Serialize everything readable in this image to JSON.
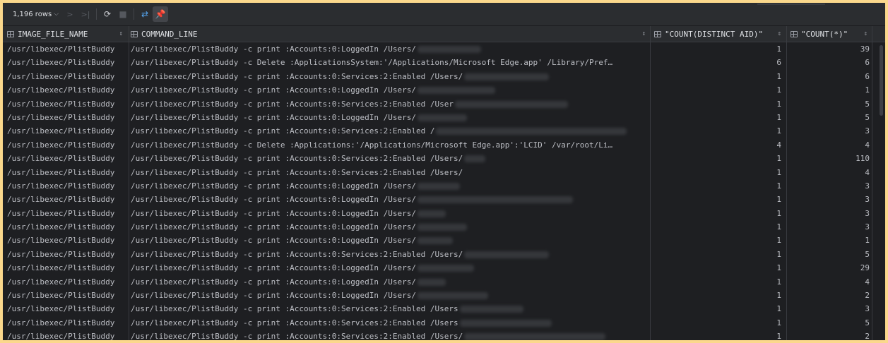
{
  "toolbar": {
    "rows_label": "1,196 rows",
    "icons": [
      "chevron-down-icon",
      "next-page-icon",
      "last-page-icon",
      "refresh-icon",
      "stop-icon",
      "transpose-icon",
      "pin-icon"
    ]
  },
  "columns": [
    {
      "name": "IMAGE_FILE_NAME"
    },
    {
      "name": "COMMAND_LINE"
    },
    {
      "name": "\"COUNT(DISTINCT AID)\""
    },
    {
      "name": "\"COUNT(*)\""
    }
  ],
  "rows": [
    {
      "image": "/usr/libexec/PlistBuddy",
      "cmd": "/usr/libexec/PlistBuddy -c print :Accounts:0:LoggedIn /Users/",
      "aid": "1",
      "count": "39"
    },
    {
      "image": "/usr/libexec/PlistBuddy",
      "cmd": "/usr/libexec/PlistBuddy -c Delete :ApplicationsSystem:'/Applications/Microsoft Edge.app' /Library/Pref…",
      "aid": "6",
      "count": "6"
    },
    {
      "image": "/usr/libexec/PlistBuddy",
      "cmd": "/usr/libexec/PlistBuddy -c print :Accounts:0:Services:2:Enabled /Users/",
      "aid": "1",
      "count": "6"
    },
    {
      "image": "/usr/libexec/PlistBuddy",
      "cmd": "/usr/libexec/PlistBuddy -c print :Accounts:0:LoggedIn /Users/",
      "aid": "1",
      "count": "1"
    },
    {
      "image": "/usr/libexec/PlistBuddy",
      "cmd": "/usr/libexec/PlistBuddy -c print :Accounts:0:Services:2:Enabled /User",
      "aid": "1",
      "count": "5"
    },
    {
      "image": "/usr/libexec/PlistBuddy",
      "cmd": "/usr/libexec/PlistBuddy -c print :Accounts:0:LoggedIn /Users/",
      "aid": "1",
      "count": "5"
    },
    {
      "image": "/usr/libexec/PlistBuddy",
      "cmd": "/usr/libexec/PlistBuddy -c print :Accounts:0:Services:2:Enabled /",
      "aid": "1",
      "count": "3"
    },
    {
      "image": "/usr/libexec/PlistBuddy",
      "cmd": "/usr/libexec/PlistBuddy -c Delete :Applications:'/Applications/Microsoft Edge.app':'LCID' /var/root/Li…",
      "aid": "4",
      "count": "4"
    },
    {
      "image": "/usr/libexec/PlistBuddy",
      "cmd": "/usr/libexec/PlistBuddy -c print :Accounts:0:Services:2:Enabled /Users/",
      "aid": "1",
      "count": "110"
    },
    {
      "image": "/usr/libexec/PlistBuddy",
      "cmd": "/usr/libexec/PlistBuddy -c print :Accounts:0:Services:2:Enabled /Users/",
      "aid": "1",
      "count": "4"
    },
    {
      "image": "/usr/libexec/PlistBuddy",
      "cmd": "/usr/libexec/PlistBuddy -c print :Accounts:0:LoggedIn /Users/",
      "aid": "1",
      "count": "3"
    },
    {
      "image": "/usr/libexec/PlistBuddy",
      "cmd": "/usr/libexec/PlistBuddy -c print :Accounts:0:LoggedIn /Users/",
      "aid": "1",
      "count": "3"
    },
    {
      "image": "/usr/libexec/PlistBuddy",
      "cmd": "/usr/libexec/PlistBuddy -c print :Accounts:0:LoggedIn /Users/",
      "aid": "1",
      "count": "3"
    },
    {
      "image": "/usr/libexec/PlistBuddy",
      "cmd": "/usr/libexec/PlistBuddy -c print :Accounts:0:LoggedIn /Users/",
      "aid": "1",
      "count": "3"
    },
    {
      "image": "/usr/libexec/PlistBuddy",
      "cmd": "/usr/libexec/PlistBuddy -c print :Accounts:0:LoggedIn /Users/",
      "aid": "1",
      "count": "1"
    },
    {
      "image": "/usr/libexec/PlistBuddy",
      "cmd": "/usr/libexec/PlistBuddy -c print :Accounts:0:Services:2:Enabled /Users/",
      "aid": "1",
      "count": "5"
    },
    {
      "image": "/usr/libexec/PlistBuddy",
      "cmd": "/usr/libexec/PlistBuddy -c print :Accounts:0:LoggedIn /Users/",
      "aid": "1",
      "count": "29"
    },
    {
      "image": "/usr/libexec/PlistBuddy",
      "cmd": "/usr/libexec/PlistBuddy -c print :Accounts:0:LoggedIn /Users/",
      "aid": "1",
      "count": "4"
    },
    {
      "image": "/usr/libexec/PlistBuddy",
      "cmd": "/usr/libexec/PlistBuddy -c print :Accounts:0:LoggedIn /Users/",
      "aid": "1",
      "count": "2"
    },
    {
      "image": "/usr/libexec/PlistBuddy",
      "cmd": "/usr/libexec/PlistBuddy -c print :Accounts:0:Services:2:Enabled /Users",
      "aid": "1",
      "count": "3"
    },
    {
      "image": "/usr/libexec/PlistBuddy",
      "cmd": "/usr/libexec/PlistBuddy -c print :Accounts:0:Services:2:Enabled /Users",
      "aid": "1",
      "count": "5"
    },
    {
      "image": "/usr/libexec/PlistBuddy",
      "cmd": "/usr/libexec/PlistBuddy -c print :Accounts:0:Services:2:Enabled /Users/",
      "aid": "1",
      "count": "2"
    }
  ]
}
